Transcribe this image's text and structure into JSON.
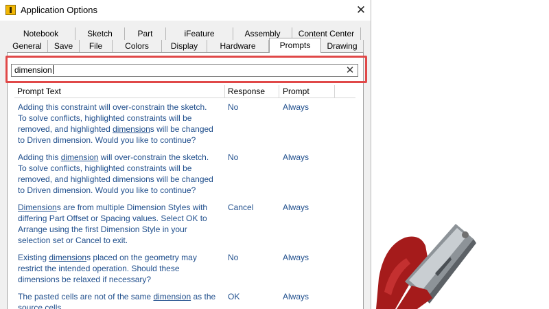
{
  "window": {
    "title": "Application Options",
    "close_label": "✕"
  },
  "tabs": {
    "row1": [
      "Notebook",
      "Sketch",
      "Part",
      "iFeature",
      "Assembly",
      "Content Center"
    ],
    "row2": [
      "General",
      "Save",
      "File",
      "Colors",
      "Display",
      "Hardware",
      "Prompts",
      "Drawing"
    ],
    "active": "Prompts"
  },
  "search": {
    "value": "dimension",
    "clear_label": "✕"
  },
  "table": {
    "columns": [
      "Prompt Text",
      "Response",
      "Prompt"
    ],
    "rows": [
      {
        "lines": [
          [
            "Adding this constraint will over-constrain the sketch."
          ],
          [
            "To solve conflicts, highlighted constraints will be"
          ],
          [
            "removed,  and highlighted ",
            {
              "u": "dimension"
            },
            "s will be changed"
          ],
          [
            "to Driven dimension.  Would you like to continue?"
          ]
        ],
        "response": "No",
        "prompt": "Always"
      },
      {
        "lines": [
          [
            "Adding this ",
            {
              "u": "dimension"
            },
            " will over-constrain the sketch."
          ],
          [
            "To solve conflicts, highlighted constraints will be"
          ],
          [
            "removed,  and highlighted dimensions will be changed"
          ],
          [
            "to Driven dimension.  Would you like to continue?"
          ]
        ],
        "response": "No",
        "prompt": "Always"
      },
      {
        "lines": [
          [
            {
              "u": "Dimension"
            },
            "s are from multiple Dimension Styles with"
          ],
          [
            "differing Part Offset or Spacing values. Select OK to"
          ],
          [
            "Arrange using the first Dimension Style in your"
          ],
          [
            "selection set or Cancel to exit."
          ]
        ],
        "response": "Cancel",
        "prompt": "Always"
      },
      {
        "lines": [
          [
            "Existing ",
            {
              "u": "dimension"
            },
            "s placed on the geometry may"
          ],
          [
            "restrict the intended operation. Should these"
          ],
          [
            "dimensions be relaxed if necessary?"
          ]
        ],
        "response": "No",
        "prompt": "Always"
      },
      {
        "lines": [
          [
            "The pasted cells are not of the same ",
            {
              "u": "dimension"
            },
            " as the"
          ],
          [
            "source cells."
          ]
        ],
        "response": "OK",
        "prompt": "Always"
      }
    ]
  },
  "colors": {
    "link_text": "#1f4e8c",
    "highlight": "#e04848",
    "icon_yellow": "#f2b705"
  }
}
